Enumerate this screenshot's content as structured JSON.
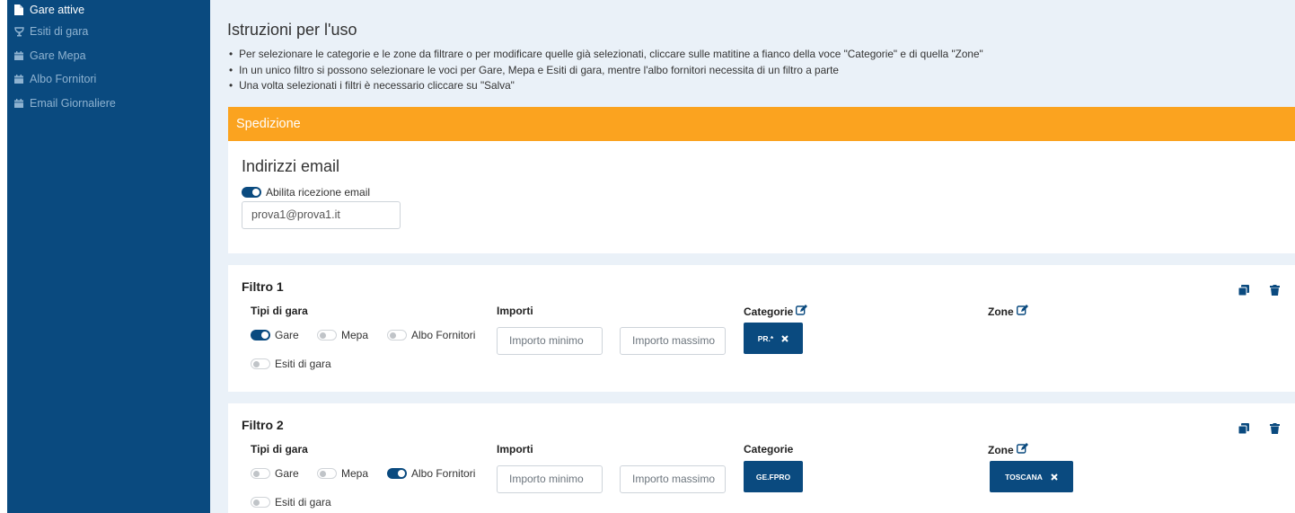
{
  "sidebar": {
    "items": [
      {
        "label": "Gare attive",
        "icon": "document-icon",
        "active": true
      },
      {
        "label": "Esiti di gara",
        "icon": "trophy-icon",
        "active": false
      },
      {
        "label": "Gare Mepa",
        "icon": "calendar-icon",
        "active": false
      },
      {
        "label": "Albo Fornitori",
        "icon": "calendar-icon",
        "active": false
      },
      {
        "label": "Email Giornaliere",
        "icon": "calendar-icon",
        "active": false
      }
    ]
  },
  "instructions": {
    "title": "Istruzioni per l'uso",
    "items": [
      "Per selezionare le categorie e le zone da filtrare o per modificare quelle già selezionati, cliccare sulle matitine a fianco della voce \"Categorie\" e di quella \"Zone\"",
      "In un unico filtro si possono selezionare le voci per Gare, Mepa e Esiti di gara, mentre l'albo fornitori necessita di un filtro a parte",
      "Una volta selezionati i filtri è necessario cliccare su \"Salva\""
    ]
  },
  "spedizione": {
    "header": "Spedizione",
    "subtitle": "Indirizzi email",
    "toggle_label": "Abilita ricezione email",
    "toggle_on": true,
    "email_value": "prova1@prova1.it"
  },
  "labels": {
    "tipi": "Tipi di gara",
    "importi": "Importi",
    "categorie": "Categorie",
    "zone": "Zone",
    "gare": "Gare",
    "mepa": "Mepa",
    "albo": "Albo Fornitori",
    "esiti": "Esiti di gara",
    "imp_min_placeholder": "Importo minimo",
    "imp_max_placeholder": "Importo massimo"
  },
  "filters": [
    {
      "title": "Filtro 1",
      "categorie_editable": true,
      "zone_editable": true,
      "toggles": {
        "gare": true,
        "mepa": false,
        "albo": false,
        "esiti": false
      },
      "categorie_chip": "PR.*",
      "zone_chip": null
    },
    {
      "title": "Filtro 2",
      "categorie_editable": false,
      "zone_editable": true,
      "toggles": {
        "gare": false,
        "mepa": false,
        "albo": true,
        "esiti": false
      },
      "categorie_chip": "GE.FPRO",
      "zone_chip": "TOSCANA"
    }
  ],
  "colors": {
    "sidebar": "#0a4a7f",
    "accent_orange": "#fba31f",
    "background": "#eaf1f8",
    "chip": "#0a4a7f"
  }
}
